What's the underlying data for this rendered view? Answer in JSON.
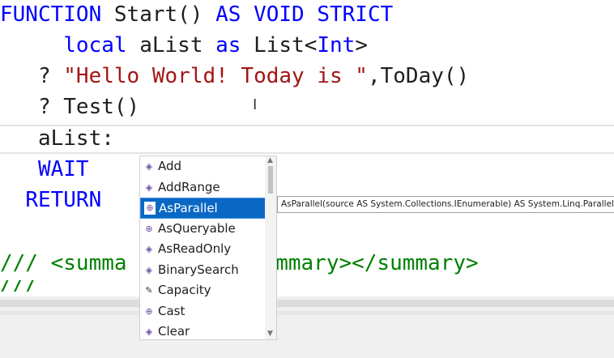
{
  "code": {
    "l1": {
      "kw1": "FUNCTION",
      "name": " Start() ",
      "kw2": "AS VOID STRICT"
    },
    "l2": {
      "indent": "     ",
      "kw1": "local",
      "mid": " aList ",
      "kw2": "as",
      "mid2": " List<",
      "kw3": "Int",
      "tail": ">"
    },
    "l3": {
      "indent": "   ",
      "q": "? ",
      "str": "\"Hello World! Today is \"",
      "tail": ",ToDay()"
    },
    "l4": {
      "indent": "   ",
      "text": "? Test()"
    },
    "l5": {
      "indent": "   ",
      "text": "aList:"
    },
    "l6": {
      "indent": "   ",
      "kw": "WAIT"
    },
    "l7": {
      "indent": "  ",
      "kw": "RETURN"
    },
    "l8": {
      "left": "/// <summa",
      "right": "ummary></summary>"
    },
    "l9": {
      "text": "///   "
    }
  },
  "completion": {
    "items": [
      {
        "label": "Add",
        "icon": "method-icon"
      },
      {
        "label": "AddRange",
        "icon": "method-icon"
      },
      {
        "label": "AsParallel",
        "icon": "extension-method-icon"
      },
      {
        "label": "AsQueryable",
        "icon": "extension-method-icon"
      },
      {
        "label": "AsReadOnly",
        "icon": "method-icon"
      },
      {
        "label": "BinarySearch",
        "icon": "method-icon"
      },
      {
        "label": "Capacity",
        "icon": "property-wrench-icon"
      },
      {
        "label": "Cast",
        "icon": "extension-method-icon"
      },
      {
        "label": "Clear",
        "icon": "method-icon"
      }
    ],
    "selected_index": 2
  },
  "tooltip": {
    "text": "AsParallel(source AS System.Collections.IEnumerable) AS System.Linq.ParallelQuery"
  },
  "colors": {
    "keyword": "#0000ff",
    "string": "#a31515",
    "comment": "#008000",
    "selection": "#0a68c4"
  }
}
